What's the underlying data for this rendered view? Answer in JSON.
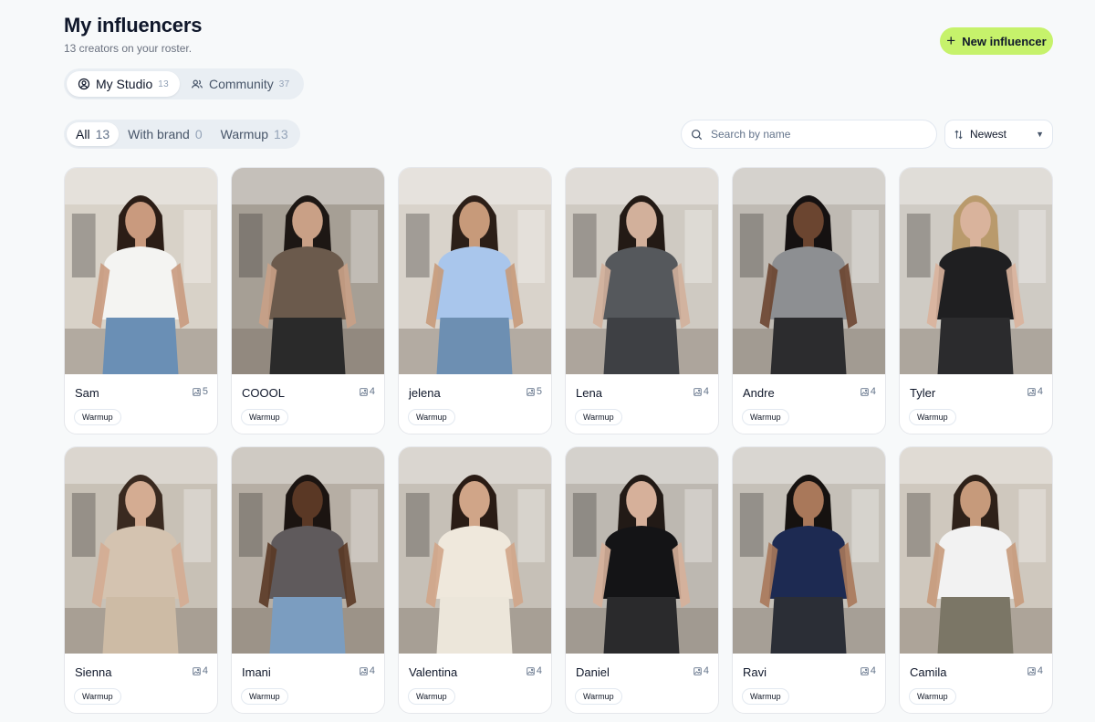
{
  "header": {
    "title": "My influencers",
    "subtitle": "13 creators on your roster.",
    "new_button_label": "New influencer"
  },
  "scope_tabs": [
    {
      "label": "My Studio",
      "count": "13",
      "icon": "user-circle-icon",
      "active": true
    },
    {
      "label": "Community",
      "count": "37",
      "icon": "users-icon",
      "active": false
    }
  ],
  "filter_tabs": [
    {
      "label": "All",
      "count": "13",
      "active": true
    },
    {
      "label": "With brand",
      "count": "0",
      "active": false
    },
    {
      "label": "Warmup",
      "count": "13",
      "active": false
    }
  ],
  "search": {
    "placeholder": "Search by name",
    "value": ""
  },
  "sort": {
    "label": "Newest",
    "icon": "sort-arrows-icon"
  },
  "influencers": [
    {
      "name": "Sam",
      "count": "5",
      "tag": "Warmup",
      "top": "#f4f4f2",
      "bottom": "#6a8fb5",
      "skin": "#c99a7e",
      "hair": "#2b1d16",
      "bg": "#d8d2c8"
    },
    {
      "name": "COOOL",
      "count": "4",
      "tag": "Warmup",
      "top": "#6b5a4c",
      "bottom": "#2a2a2a",
      "skin": "#c9a086",
      "hair": "#1d1714",
      "bg": "#a69f95"
    },
    {
      "name": "jelena",
      "count": "5",
      "tag": "Warmup",
      "top": "#a9c6ec",
      "bottom": "#6d8fb2",
      "skin": "#c79a7a",
      "hair": "#2c1f18",
      "bg": "#d9d3cb"
    },
    {
      "name": "Lena",
      "count": "4",
      "tag": "Warmup",
      "top": "#55585c",
      "bottom": "#3e4044",
      "skin": "#d2b09b",
      "hair": "#231a15",
      "bg": "#cfcac2"
    },
    {
      "name": "Andre",
      "count": "4",
      "tag": "Warmup",
      "top": "#8d8f92",
      "bottom": "#2c2c2e",
      "skin": "#6b4530",
      "hair": "#151111",
      "bg": "#bfbab3"
    },
    {
      "name": "Tyler",
      "count": "4",
      "tag": "Warmup",
      "top": "#1f1f21",
      "bottom": "#2b2b2d",
      "skin": "#d9b39c",
      "hair": "#b99a6c",
      "bg": "#cfcbc4"
    },
    {
      "name": "Sienna",
      "count": "4",
      "tag": "Warmup",
      "top": "#d4c3b0",
      "bottom": "#cdbba5",
      "skin": "#d4ac92",
      "hair": "#3a2a20",
      "bg": "#c8c1b6"
    },
    {
      "name": "Imani",
      "count": "4",
      "tag": "Warmup",
      "top": "#5f5a5c",
      "bottom": "#7b9dc0",
      "skin": "#5a3825",
      "hair": "#1b1411",
      "bg": "#b6aea4"
    },
    {
      "name": "Valentina",
      "count": "4",
      "tag": "Warmup",
      "top": "#efe8dc",
      "bottom": "#ece6da",
      "skin": "#d0a588",
      "hair": "#2a1c15",
      "bg": "#c6c0b7"
    },
    {
      "name": "Daniel",
      "count": "4",
      "tag": "Warmup",
      "top": "#141416",
      "bottom": "#2a2a2c",
      "skin": "#d6b09a",
      "hair": "#221a16",
      "bg": "#bdb8b1"
    },
    {
      "name": "Ravi",
      "count": "4",
      "tag": "Warmup",
      "top": "#1d2a52",
      "bottom": "#2b2e36",
      "skin": "#a9785a",
      "hair": "#161210",
      "bg": "#c5c0b8"
    },
    {
      "name": "Camila",
      "count": "4",
      "tag": "Warmup",
      "top": "#f2f2f2",
      "bottom": "#7b7666",
      "skin": "#c69a7b",
      "hair": "#2e2119",
      "bg": "#cfc8be"
    }
  ]
}
